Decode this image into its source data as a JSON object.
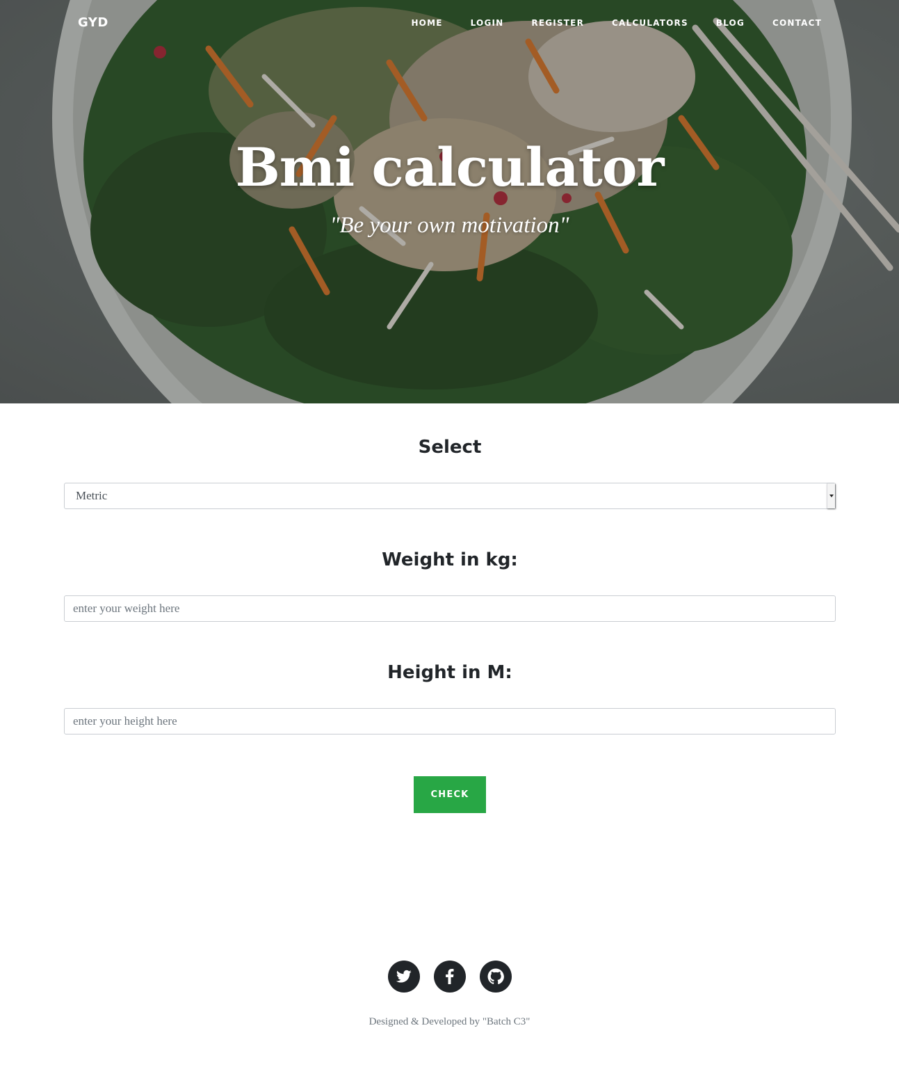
{
  "navbar": {
    "brand": "GYD",
    "links": [
      "HOME",
      "LOGIN",
      "REGISTER",
      "CALCULATORS",
      "BLOG",
      "CONTACT"
    ]
  },
  "hero": {
    "title": "Bmi calculator",
    "subtitle": "\"Be your own motivation\""
  },
  "form": {
    "select_label": "Select",
    "select_value": "Metric",
    "weight_label": "Weight in kg:",
    "weight_placeholder": "enter your weight here",
    "height_label": "Height in M:",
    "height_placeholder": "enter your height here",
    "check_label": "CHECK"
  },
  "footer": {
    "socials": [
      "twitter-icon",
      "facebook-icon",
      "github-icon"
    ],
    "credit": "Designed & Developed by \"Batch C3\""
  },
  "colors": {
    "accent_green": "#28a745",
    "social_bg": "#212529"
  }
}
